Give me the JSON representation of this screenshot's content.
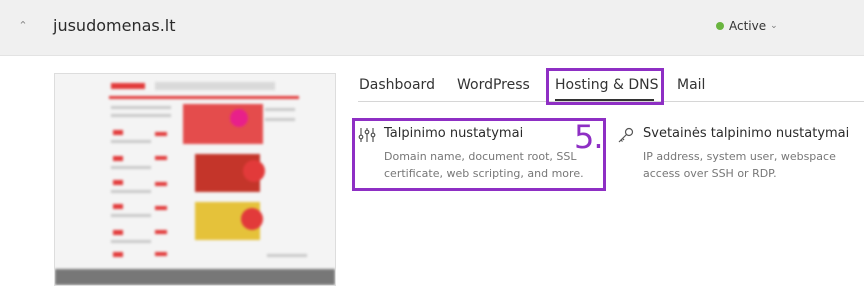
{
  "domain": {
    "name": "jusudomenas.lt",
    "status_label": "Active",
    "status_color": "#6ab53f"
  },
  "tabs": [
    {
      "label": "Dashboard"
    },
    {
      "label": "WordPress"
    },
    {
      "label": "Hosting & DNS",
      "active": true
    },
    {
      "label": "Mail"
    }
  ],
  "cards": [
    {
      "icon": "sliders-icon",
      "title": "Talpinimo nustatymai",
      "description": "Domain name, document root, SSL certificate, web scripting, and more."
    },
    {
      "icon": "key-icon",
      "title": "Svetainės talpinimo nustatymai",
      "description": "IP address, system user, webspace access over SSH or RDP."
    }
  ],
  "annotation": {
    "step_label": "5.",
    "highlight_color": "#8e2fc4"
  }
}
